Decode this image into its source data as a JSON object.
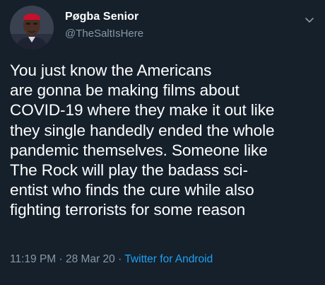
{
  "author": {
    "display_name": "Pøgba Senior",
    "handle": "@TheSaltIsHere"
  },
  "tweet": {
    "text": "You just know the Americans\nare gonna be making films about\nCOVID-19 where they make it out like\nthey single handedly ended the whole\npandemic themselves. Someone like\nThe Rock will play the badass sci-\nentist who finds the cure while also\nfighting terrorists for some reason",
    "time": "11:19 PM",
    "date": "28 Mar 20",
    "separator": "·",
    "source": "Twitter for Android"
  },
  "icons": {
    "avatar": "profile-photo",
    "menu": "chevron-down-icon"
  },
  "colors": {
    "background": "#15202b",
    "text": "#ffffff",
    "secondary": "#8899a6",
    "accent": "#1da1f2"
  }
}
